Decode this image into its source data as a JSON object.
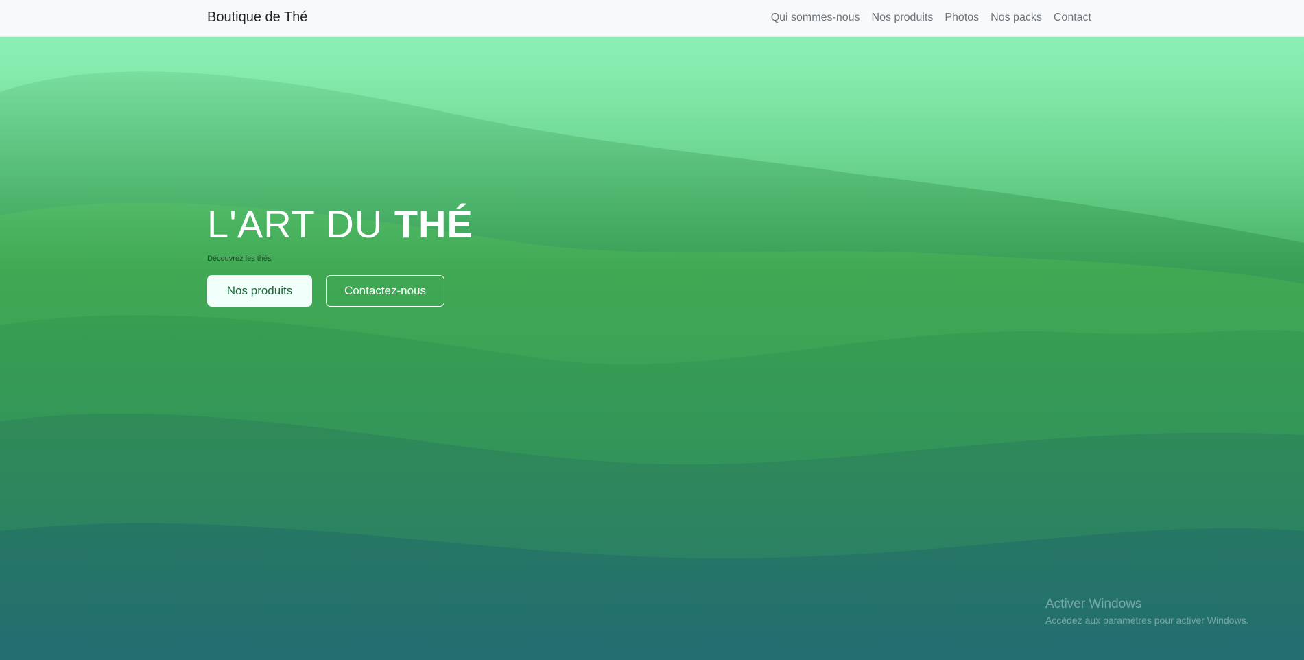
{
  "navbar": {
    "brand": "Boutique de Thé",
    "links": [
      "Qui sommes-nous",
      "Nos produits",
      "Photos",
      "Nos packs",
      "Contact"
    ]
  },
  "hero": {
    "title_light": "L'ART DU ",
    "title_bold": "THÉ",
    "subtitle": "Découvrez les thés",
    "primary_button": "Nos produits",
    "secondary_button": "Contactez-nous"
  },
  "watermark": {
    "title": "Activer Windows",
    "subtitle": "Accédez aux paramètres pour activer Windows."
  },
  "colors": {
    "navbar_bg": "#f8f9fa",
    "hero_top": "#7de8a0",
    "hero_bottom": "#21678a",
    "primary_button_bg": "#f1fffb",
    "primary_button_text": "#1f6b3a"
  }
}
